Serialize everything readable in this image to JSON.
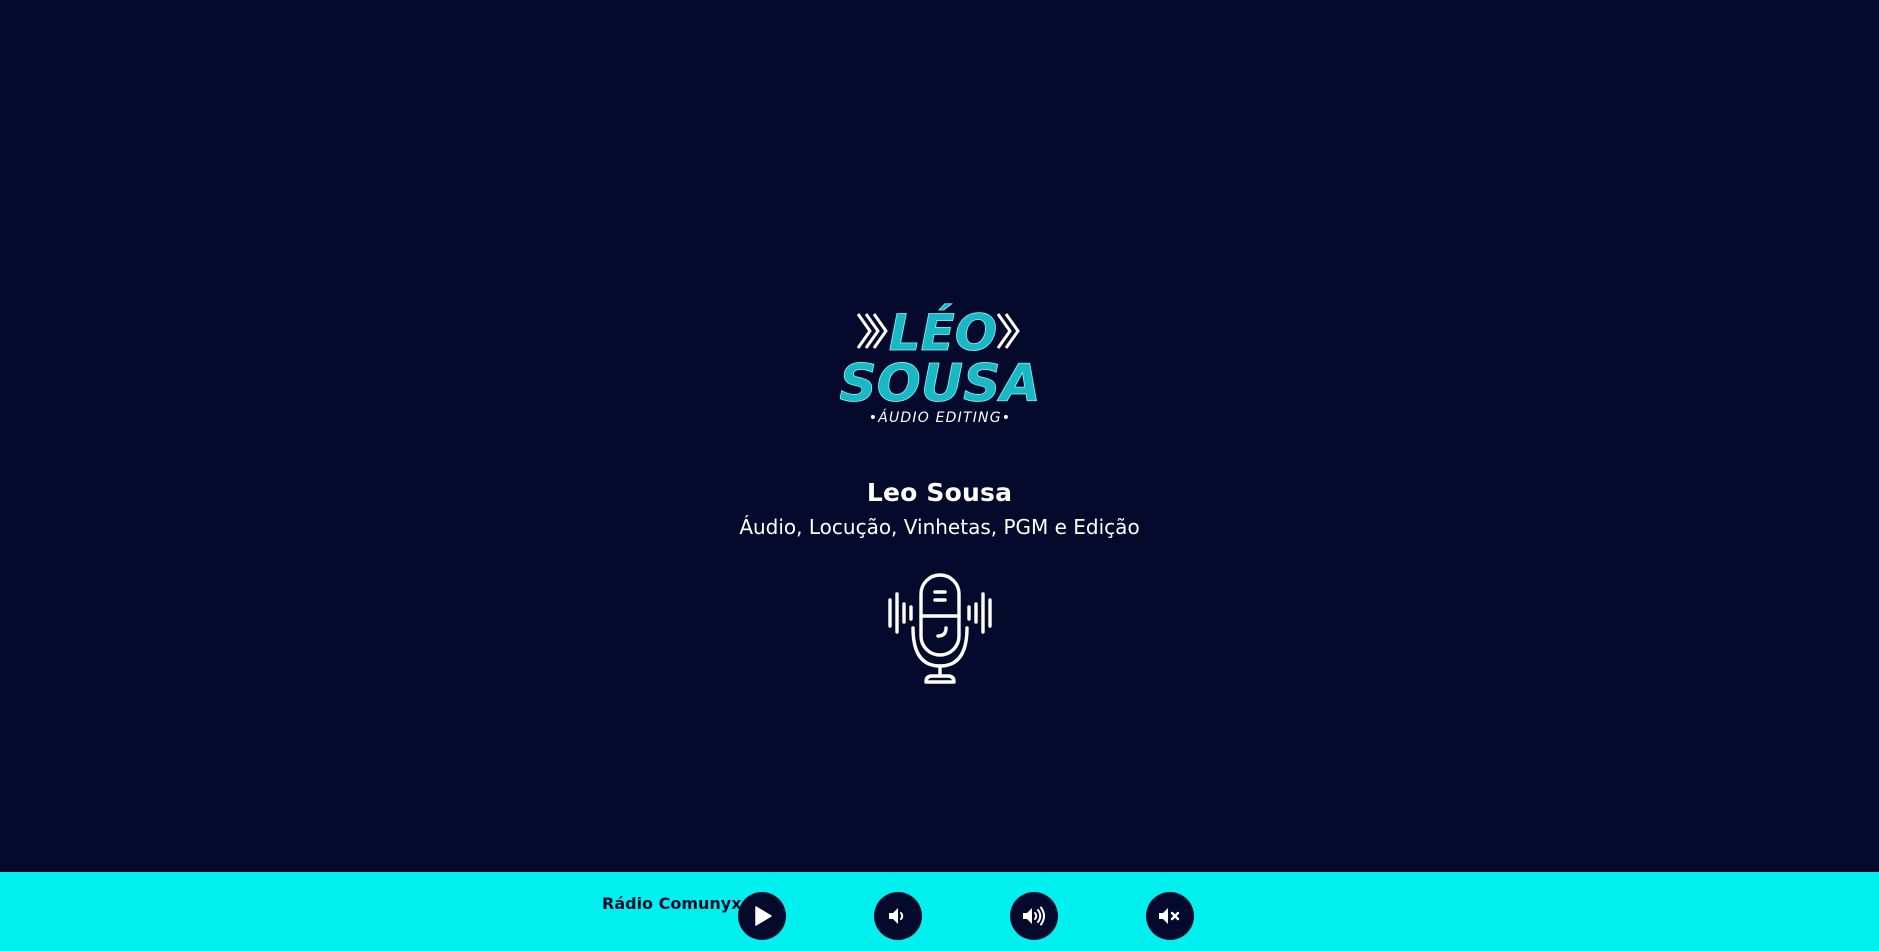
{
  "logo": {
    "line1": "LÉO",
    "line2": "SOUSA",
    "tagline": "•ÁUDIO EDITING•"
  },
  "header": {
    "title": "Leo Sousa",
    "subtitle": "Áudio, Locução, Vinhetas, PGM e Edição"
  },
  "player": {
    "station_name": "Rádio Comunyx",
    "buttons": [
      {
        "icon": "play-icon"
      },
      {
        "icon": "volume-down-icon"
      },
      {
        "icon": "volume-up-icon"
      },
      {
        "icon": "mute-icon"
      }
    ]
  },
  "colors": {
    "background": "#050a2c",
    "accent": "#00f0f0",
    "logo_teal": "#19b8c4",
    "text": "#ffffff"
  }
}
